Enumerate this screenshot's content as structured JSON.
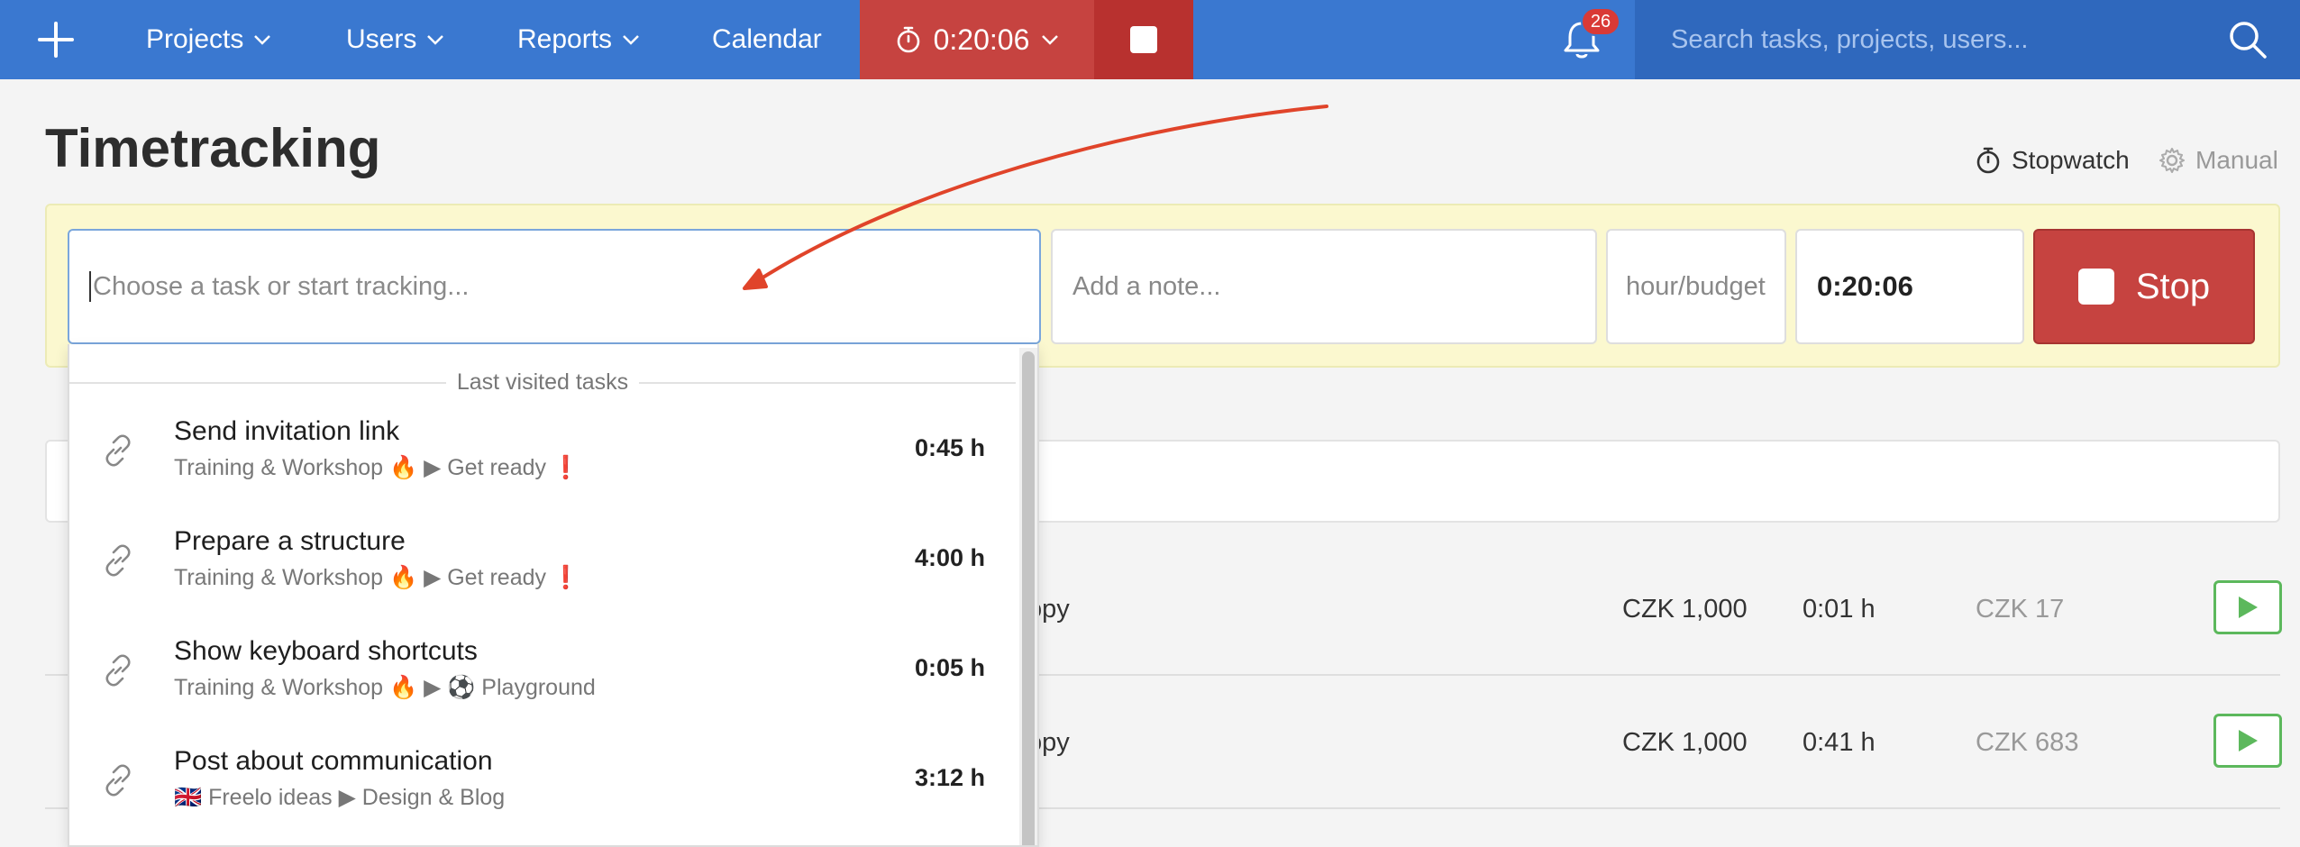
{
  "topbar": {
    "nav": [
      {
        "label": "Projects",
        "dropdown": true
      },
      {
        "label": "Users",
        "dropdown": true
      },
      {
        "label": "Reports",
        "dropdown": true
      },
      {
        "label": "Calendar",
        "dropdown": false
      }
    ],
    "timer": "0:20:06",
    "notifications": "26",
    "search_placeholder": "Search tasks, projects, users..."
  },
  "page": {
    "title": "Timetracking",
    "modes": [
      {
        "label": "Stopwatch",
        "icon": "stopwatch-icon",
        "active": true
      },
      {
        "label": "Manual",
        "icon": "gear-icon",
        "active": false
      }
    ]
  },
  "tracker": {
    "task_placeholder": "Choose a task or start tracking...",
    "note_placeholder": "Add a note...",
    "budget_placeholder": "hour/budget",
    "time": "0:20:06",
    "stop_label": "Stop"
  },
  "dropdown": {
    "header": "Last visited tasks",
    "items": [
      {
        "name": "Send invitation link",
        "path": "Training & Workshop 🔥 ▶ Get ready",
        "urgent": "❗",
        "hours": "0:45 h"
      },
      {
        "name": "Prepare a structure",
        "path": "Training & Workshop 🔥 ▶ Get ready",
        "urgent": "❗",
        "hours": "4:00 h"
      },
      {
        "name": "Show keyboard shortcuts",
        "path": "Training & Workshop 🔥 ▶ ⚽ Playground",
        "urgent": "",
        "hours": "0:05 h"
      },
      {
        "name": "Post about communication",
        "path": "🇬🇧 Freelo ideas ▶ Design & Blog",
        "urgent": "",
        "hours": "3:12 h"
      }
    ]
  },
  "background_rows": [
    {
      "text": "opy",
      "rate": "CZK 1,000",
      "time": "0:01 h",
      "cost": "CZK 17"
    },
    {
      "text": "opy",
      "rate": "CZK 1,000",
      "time": "0:41 h",
      "cost": "CZK 683"
    }
  ],
  "colors": {
    "topbar": "#3a78d0",
    "timer": "#c64340",
    "stop": "#c64340",
    "panel": "#fbf8cf",
    "play": "#5cb85c",
    "annotation_arrow": "#e0442a"
  }
}
